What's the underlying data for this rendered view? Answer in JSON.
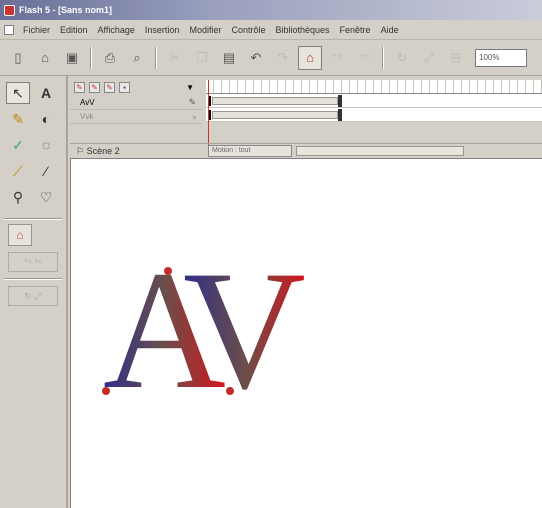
{
  "window": {
    "title": "Flash 5 - [Sans nom1]"
  },
  "menu": [
    "Fichier",
    "Edition",
    "Affichage",
    "Insertion",
    "Modifier",
    "Contrôle",
    "Bibliothèques",
    "Fenêtre",
    "Aide"
  ],
  "toolbar": {
    "zoom_value": "100%"
  },
  "timeline": {
    "layers": [
      {
        "name": "AvV",
        "dim": false
      },
      {
        "name": "Vvk",
        "dim": true
      }
    ]
  },
  "scene": {
    "label": "Scène 2",
    "tab_label": "Motion : tout"
  },
  "artwork": {
    "letters": [
      "A",
      "V"
    ],
    "gradient_start": "#2e2f8a",
    "gradient_mid": "#6b4e4a",
    "gradient_end": "#d3161c",
    "handle_color": "#c42a2a"
  },
  "icons": {
    "tools": [
      "arrow-icon",
      "text-icon",
      "pencil-icon",
      "paint-bucket-icon",
      "ink-bottle-icon",
      "lasso-icon",
      "dropper-icon",
      "eraser-icon",
      "zoom-icon",
      "hand-icon"
    ],
    "toolbar": [
      "new-icon",
      "open-icon",
      "save-icon",
      "print-icon",
      "print-preview-icon",
      "cut-icon",
      "copy-icon",
      "paste-icon",
      "undo-icon",
      "redo-icon",
      "snap-icon",
      "smooth-icon",
      "straighten-icon",
      "rotate-icon",
      "scale-icon",
      "align-icon"
    ]
  }
}
